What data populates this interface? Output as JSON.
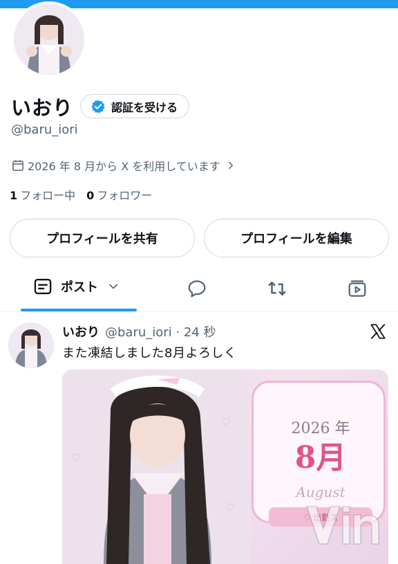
{
  "profile": {
    "name": "いおり",
    "verify_label": "認証を受ける",
    "handle": "@baru_iori",
    "joined_text": "2026 年 8 月から X を利用しています",
    "following_count": "1",
    "following_label": "フォロー中",
    "followers_count": "0",
    "followers_label": "フォロワー"
  },
  "actions": {
    "share_label": "プロフィールを共有",
    "edit_label": "プロフィールを編集"
  },
  "tabs": {
    "active_label": "ポスト"
  },
  "post": {
    "author": "いおり",
    "meta": "@baru_iori · 24 秒",
    "text": "また凍結しました8月よろしく",
    "image": {
      "year": "2026 年",
      "month": "8月",
      "english": "August",
      "ribbon": "♡ 出勤ス"
    }
  },
  "colors": {
    "accent": "#1d9bf0",
    "muted": "#536471",
    "border": "#cfd9de"
  }
}
